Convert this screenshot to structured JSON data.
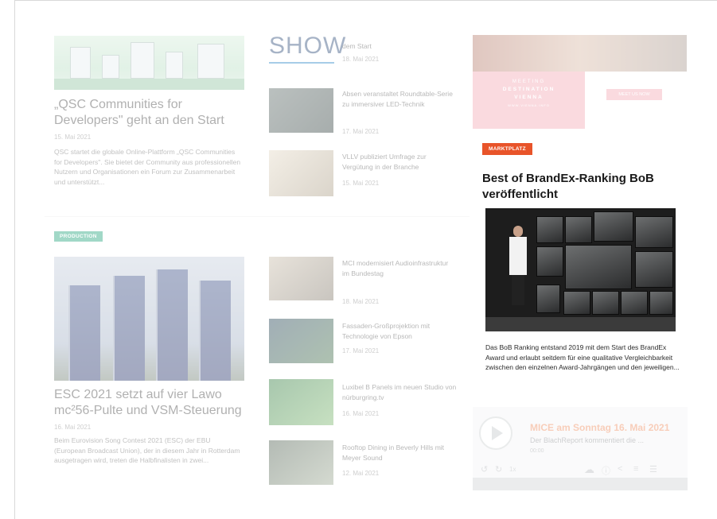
{
  "left": {
    "article1": {
      "title": "„QSC Communities for Developers\" geht an den Start",
      "date": "15. Mai 2021",
      "excerpt": "QSC startet die globale Online-Plattform „QSC Communities for Developers\". Sie bietet der Community aus professionellen Nutzern und Organisationen ein Forum zur Zusammenarbeit und unterstützt..."
    },
    "tag_production": "PRODUCTION",
    "article2": {
      "title": "ESC 2021 setzt auf vier Lawo mc²56-Pulte und VSM-Steuerung",
      "date": "16. Mai 2021",
      "excerpt": "Beim Eurovision Song Contest 2021 (ESC) der EBU (European Broadcast Union), der in diesem Jahr in Rotterdam ausgetragen wird, treten die Halbfinalisten in zwei..."
    }
  },
  "middle": {
    "logo_text": "SHOW",
    "top_items": [
      {
        "title": "dem Start",
        "date": "18. Mai 2021"
      },
      {
        "title": "Absen veranstaltet Roundtable-Serie zu immersiver LED-Technik",
        "date": "17. Mai 2021"
      },
      {
        "title": "VLLV publiziert Umfrage zur Vergütung in der Branche",
        "date": "15. Mai 2021"
      }
    ],
    "bottom_items": [
      {
        "title": "MCI modernisiert Audioinfrastruktur im Bundestag",
        "date": "18. Mai 2021"
      },
      {
        "title": "Fassaden-Großprojektion mit Technologie von Epson",
        "date": "17. Mai 2021"
      },
      {
        "title": "Luxibel B Panels im neuen Studio von nürburgring.tv",
        "date": "16. Mai 2021"
      },
      {
        "title": "Rooftop Dining in Beverly Hills mit Meyer Sound",
        "date": "12. Mai 2021"
      }
    ]
  },
  "right": {
    "ad": {
      "line1": "MEETING",
      "line2": "DESTINATION",
      "line3": "VIENNA",
      "line4": "WWW.VIENNA.INFO",
      "button": "MEET US NOW"
    },
    "tag": "MARKTPLATZ",
    "title": "Best of BrandEx-Ranking BoB veröffentlicht",
    "excerpt": "Das BoB Ranking entstand 2019 mit dem Start des BrandEx Award und erlaubt seitdem für eine qualitative Vergleichbarkeit zwischen den einzelnen Award-Jahrgängen und den jeweiligen..."
  },
  "player": {
    "title": "MICE am Sonntag 16. Mai 2021",
    "subtitle": "Der BlachReport kommentiert die ...",
    "time": "00:00",
    "rate": "1x"
  },
  "colors": {
    "tag_production": "#1fa37a",
    "tag_marktplatz": "#e8542a",
    "ad_pink": "#f2a7b4",
    "player_title": "#ef8a5a"
  }
}
